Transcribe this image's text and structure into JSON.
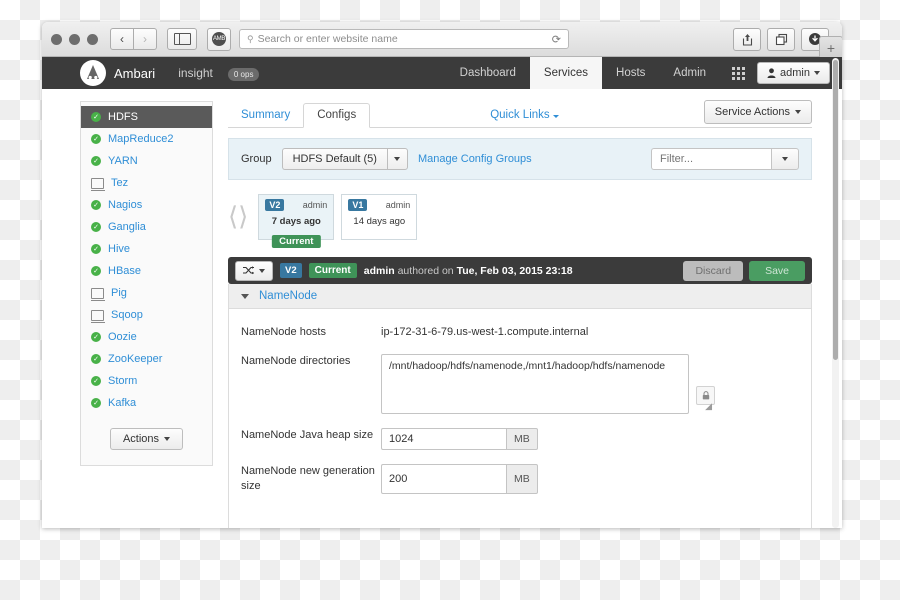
{
  "browser": {
    "traffic_lights": [
      "close",
      "minimize",
      "zoom"
    ],
    "back_label": "‹",
    "forward_label": "›",
    "sidebar_toggle": "sidebar-icon",
    "favicon_label": "AMB",
    "address_placeholder": "Search or enter website name",
    "search_icon": "search-icon",
    "reload_icon": "reload-icon",
    "share_icon": "share-icon",
    "tabs_icon": "tabs-icon",
    "downloads_icon": "downloads-icon",
    "new_tab_label": "+"
  },
  "navbar": {
    "logo": "ambari-logo",
    "brand": "Ambari",
    "cluster": "insight",
    "ops_badge": "0 ops",
    "items": [
      {
        "label": "Dashboard",
        "active": false
      },
      {
        "label": "Services",
        "active": true
      },
      {
        "label": "Hosts",
        "active": false
      },
      {
        "label": "Admin",
        "active": false
      }
    ],
    "grid_icon": "apps-grid-icon",
    "user_icon": "user-icon",
    "user_label": "admin",
    "user_caret": "chevron-down-icon"
  },
  "sidebar": {
    "services": [
      {
        "label": "HDFS",
        "status": "ok",
        "active": true
      },
      {
        "label": "MapReduce2",
        "status": "ok",
        "active": false
      },
      {
        "label": "YARN",
        "status": "ok",
        "active": false
      },
      {
        "label": "Tez",
        "status": "client",
        "active": false
      },
      {
        "label": "Nagios",
        "status": "ok",
        "active": false
      },
      {
        "label": "Ganglia",
        "status": "ok",
        "active": false
      },
      {
        "label": "Hive",
        "status": "ok",
        "active": false
      },
      {
        "label": "HBase",
        "status": "ok",
        "active": false
      },
      {
        "label": "Pig",
        "status": "client",
        "active": false
      },
      {
        "label": "Sqoop",
        "status": "client",
        "active": false
      },
      {
        "label": "Oozie",
        "status": "ok",
        "active": false
      },
      {
        "label": "ZooKeeper",
        "status": "ok",
        "active": false
      },
      {
        "label": "Storm",
        "status": "ok",
        "active": false
      },
      {
        "label": "Kafka",
        "status": "ok",
        "active": false
      }
    ],
    "actions_label": "Actions"
  },
  "main": {
    "tabs": [
      {
        "label": "Summary",
        "active": false
      },
      {
        "label": "Configs",
        "active": true
      }
    ],
    "quick_links": "Quick Links",
    "service_actions": "Service Actions",
    "group_bar": {
      "group_label": "Group",
      "group_value": "HDFS Default (5)",
      "manage_link": "Manage Config Groups",
      "filter_placeholder": "Filter..."
    },
    "versions": [
      {
        "tag": "V2",
        "author": "admin",
        "age": "7 days ago",
        "current": true,
        "current_label": "Current"
      },
      {
        "tag": "V1",
        "author": "admin",
        "age": "14 days ago",
        "current": false,
        "current_label": ""
      }
    ],
    "version_bar": {
      "switch_icon": "compare-icon",
      "tag": "V2",
      "current_label": "Current",
      "author": "admin",
      "authored_text": "authored on",
      "timestamp": "Tue, Feb 03, 2015 23:18",
      "discard_label": "Discard",
      "save_label": "Save"
    },
    "panel": {
      "title": "NameNode",
      "fields": [
        {
          "label": "NameNode hosts",
          "type": "static",
          "value": "ip-172-31-6-79.us-west-1.compute.internal"
        },
        {
          "label": "NameNode directories",
          "type": "textarea",
          "value": "/mnt/hadoop/hdfs/namenode,/mnt1/hadoop/hdfs/namenode",
          "lock_icon": "lock-icon"
        },
        {
          "label": "NameNode Java heap size",
          "type": "number",
          "value": "1024",
          "unit": "MB"
        },
        {
          "label": "NameNode new generation size",
          "type": "number",
          "value": "200",
          "unit": "MB"
        }
      ]
    }
  },
  "colors": {
    "accent_link": "#2f8ed6",
    "status_ok": "#48b148",
    "version_tag": "#3878a0",
    "current_green": "#3f9358",
    "navbar_dark": "#3b3b3b",
    "group_bar": "#e8f2f7"
  }
}
